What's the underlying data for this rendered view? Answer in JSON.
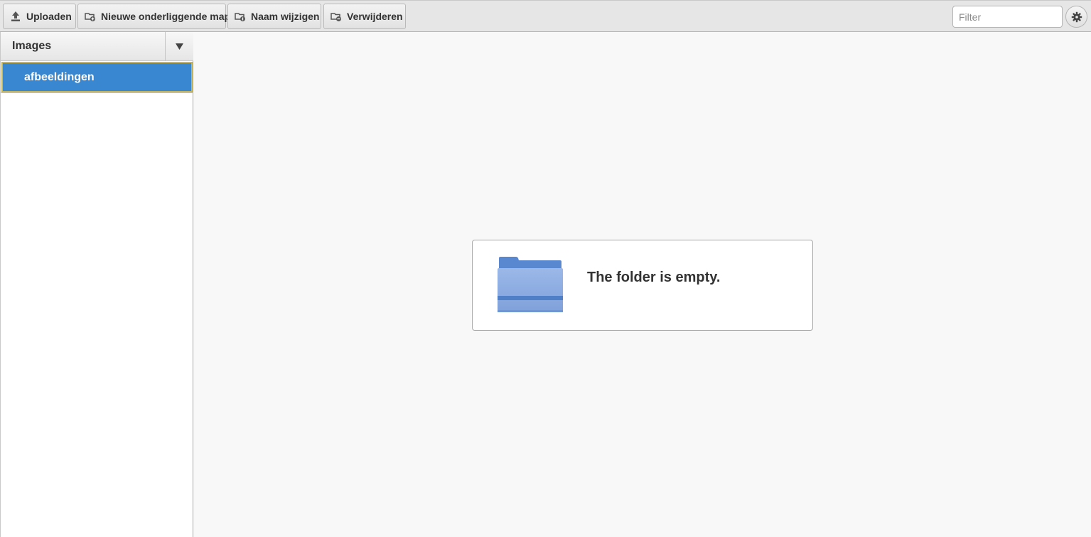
{
  "toolbar": {
    "upload_label": "Uploaden",
    "new_folder_label": "Nieuwe onderliggende map",
    "rename_label": "Naam wijzigen",
    "delete_label": "Verwijderen",
    "filter_placeholder": "Filter",
    "settings_icon": "gear-icon"
  },
  "sidebar": {
    "title": "Images",
    "toggle_icon": "caret-down-icon",
    "items": [
      {
        "label": "afbeeldingen",
        "selected": true
      }
    ]
  },
  "main": {
    "empty_message": "The folder is empty.",
    "empty_icon": "folder-icon"
  },
  "colors": {
    "selected_item_bg": "#3a87d1",
    "selected_item_border": "#c8b55a",
    "folder_blue": "#7fa4df"
  }
}
